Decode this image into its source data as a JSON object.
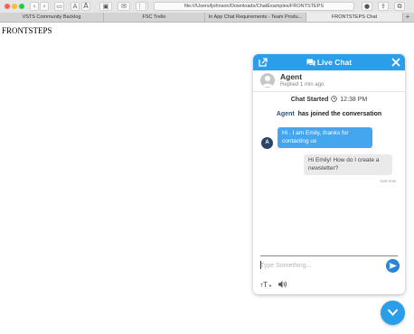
{
  "browser": {
    "url": "file:///Users/ljohnson/Downloads/ChatExamples/FRONTSTEPS",
    "font_small": "A",
    "font_large": "A",
    "tabs": [
      {
        "label": "VSTS Community Backlog",
        "active": false
      },
      {
        "label": "FSC Trello",
        "active": false
      },
      {
        "label": "In App Chat Requirements - Team Produ...",
        "active": false
      },
      {
        "label": "FRONTSTEPS Chat",
        "active": true
      }
    ],
    "new_tab": "+"
  },
  "page": {
    "title": "FRONTSTEPS"
  },
  "chat": {
    "header_title": "Live Chat",
    "agent_name": "Agent",
    "agent_status": "Replied 1 min ago",
    "started_label": "Chat Started",
    "started_time": "12:38 PM",
    "joined_name": "Agent",
    "joined_text": "has joined the conversation",
    "messages": [
      {
        "from": "agent",
        "avatar": "A",
        "text": "Hi . I am Emily, thanks for contacting us"
      },
      {
        "from": "user",
        "text": "Hi Emily! How do I create a newsletter?",
        "time": "Just now"
      }
    ],
    "input_placeholder": "Type Something...",
    "font_tool": "T"
  },
  "colors": {
    "accent": "#2a9ee9",
    "agent_bubble": "#45a6f0",
    "user_bubble": "#eaeaea",
    "avatar": "#2b4566"
  }
}
